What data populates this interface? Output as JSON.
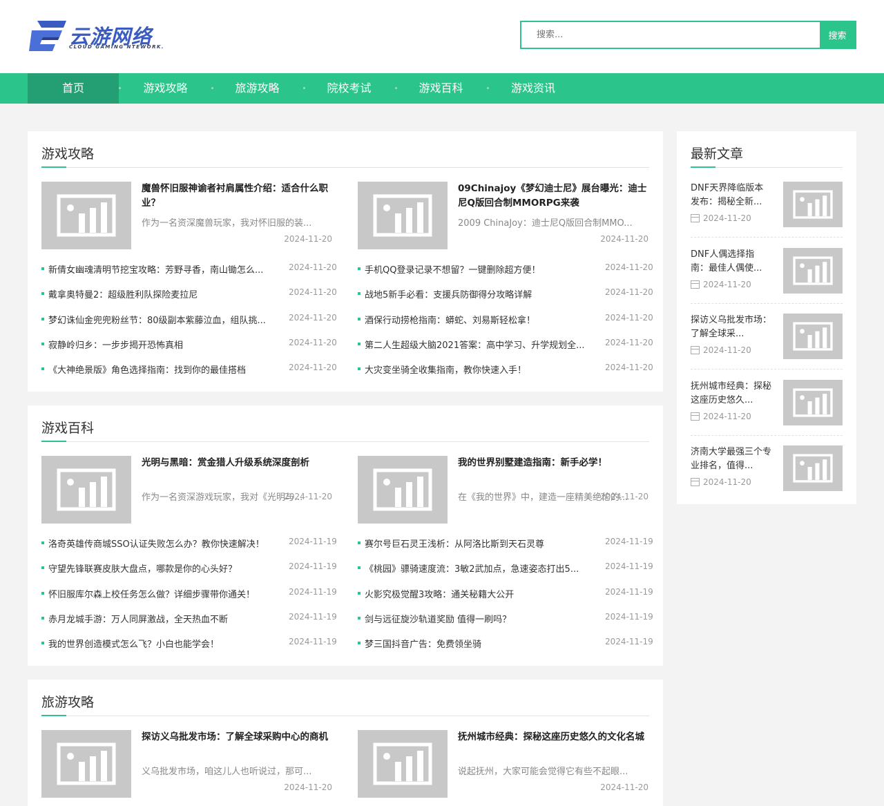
{
  "header": {
    "logo_text": "云游网络",
    "logo_sub": "CLOUD GAMING NTEWORK.",
    "search_placeholder": "搜索...",
    "search_button": "搜索"
  },
  "nav": [
    "首页",
    "游戏攻略",
    "旅游攻略",
    "院校考试",
    "游戏百科",
    "游戏资讯"
  ],
  "sections": [
    {
      "title": "游戏攻略",
      "featured": [
        {
          "title": "魔兽怀旧服神谕者衬肩属性介绍：适合什么职业？",
          "desc": "作为一名资深魔兽玩家，我对怀旧服的装...",
          "date": "2024-11-20"
        },
        {
          "title": "09Chinajoy《梦幻迪士尼》展台曝光：迪士尼Q版回合制MMORPG来袭",
          "desc": "2009 ChinaJoy：迪士尼Q版回合制MMO...",
          "date": "2024-11-20"
        }
      ],
      "list_left": [
        {
          "text": "新倩女幽魂清明节挖宝攻略：芳野寻香，南山锄怎么...",
          "date": "2024-11-20"
        },
        {
          "text": "戴拿奥特曼2：超级胜利队探险麦拉尼",
          "date": "2024-11-20"
        },
        {
          "text": "梦幻诛仙金兜兜粉丝节：80级副本紫藤泣血，组队挑...",
          "date": "2024-11-20"
        },
        {
          "text": "寂静岭归乡：一步步揭开恐怖真相",
          "date": "2024-11-20"
        },
        {
          "text": "《大神绝景版》角色选择指南：找到你的最佳搭档",
          "date": "2024-11-20"
        }
      ],
      "list_right": [
        {
          "text": "手机QQ登录记录不想留？一键删除超方便！",
          "date": "2024-11-20"
        },
        {
          "text": "战地5新手必看：支援兵防御得分攻略详解",
          "date": "2024-11-20"
        },
        {
          "text": "酒保行动捞枪指南：蟒蛇、刘易斯轻松拿！",
          "date": "2024-11-20"
        },
        {
          "text": "第二人生超级大脑2021答案：高中学习、升学规划全...",
          "date": "2024-11-20"
        },
        {
          "text": "大灾变坐骑全收集指南，教你快速入手！",
          "date": "2024-11-20"
        }
      ]
    },
    {
      "title": "游戏百科",
      "featured": [
        {
          "title": "光明与黑暗：赏金猎人升级系统深度剖析",
          "desc": "作为一名资深游戏玩家，我对《光明与...",
          "date": "2024-11-20"
        },
        {
          "title": "我的世界别墅建造指南：新手必学！",
          "desc": "在《我的世界》中，建造一座精美绝伦的...",
          "date": "2024-11-20"
        }
      ],
      "list_left": [
        {
          "text": "洛奇英雄传商城SSO认证失败怎么办？教你快速解决！",
          "date": "2024-11-19"
        },
        {
          "text": "守望先锋联赛皮肤大盘点，哪款是你的心头好？",
          "date": "2024-11-19"
        },
        {
          "text": "怀旧服库尔森上校任务怎么做？详细步骤带你通关！",
          "date": "2024-11-19"
        },
        {
          "text": "赤月龙城手游：万人同屏激战，全天热血不断",
          "date": "2024-11-19"
        },
        {
          "text": "我的世界创造模式怎么飞？小白也能学会！",
          "date": "2024-11-19"
        }
      ],
      "list_right": [
        {
          "text": "赛尔号巨石灵王浅析：从阿洛比斯到天石灵尊",
          "date": "2024-11-19"
        },
        {
          "text": "《桃园》骠骑速度流：3敏2武加点，急速姿态打出5...",
          "date": "2024-11-19"
        },
        {
          "text": "火影究极觉醒3攻略：通关秘籍大公开",
          "date": "2024-11-19"
        },
        {
          "text": "剑与远征旋沙轨道奖励 值得一刷吗？",
          "date": "2024-11-19"
        },
        {
          "text": "梦三国抖音广告：免费领坐骑",
          "date": "2024-11-19"
        }
      ]
    },
    {
      "title": "旅游攻略",
      "featured": [
        {
          "title": "探访义乌批发市场：了解全球采购中心的商机",
          "desc": "义乌批发市场，咱这儿人也听说过，那可...",
          "date": "2024-11-20"
        },
        {
          "title": "抚州城市经典：探秘这座历史悠久的文化名城",
          "desc": "说起抚州，大家可能会觉得它有些不起眼...",
          "date": "2024-11-20"
        }
      ]
    }
  ],
  "sidebar": {
    "title": "最新文章",
    "items": [
      {
        "title": "DNF天界降临版本发布：揭秘全新...",
        "date": "2024-11-20"
      },
      {
        "title": "DNF人偶选择指南：最佳人偶使...",
        "date": "2024-11-20"
      },
      {
        "title": "探访义乌批发市场：了解全球采...",
        "date": "2024-11-20"
      },
      {
        "title": "抚州城市经典：探秘这座历史悠久...",
        "date": "2024-11-20"
      },
      {
        "title": "济南大学最强三个专业排名，值得...",
        "date": "2024-11-20"
      }
    ]
  }
}
